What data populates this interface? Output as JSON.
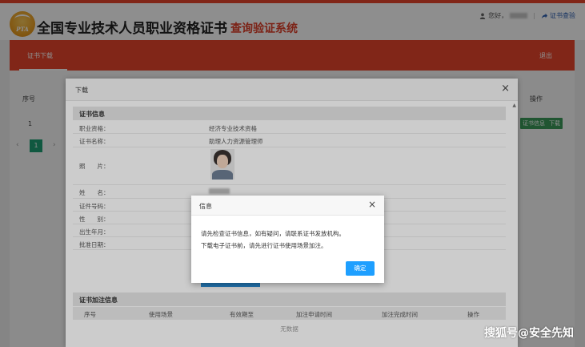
{
  "header": {
    "logo_text": "PTA",
    "title_main": "全国专业技术人员职业资格证书",
    "title_sub": "查询验证系统",
    "greeting": "您好，",
    "verify_link": "证书查验"
  },
  "nav": {
    "tab": "证书下载",
    "logout": "退出"
  },
  "background_table": {
    "col_index": "序号",
    "col_ops": "操作",
    "row_index": "1",
    "btn_info": "证书信息",
    "btn_download": "下载",
    "pager_prev": "‹",
    "pager_current": "1",
    "pager_next": "›"
  },
  "download_dialog": {
    "title": "下载",
    "close": "×",
    "section_cert": "证书信息",
    "rows": [
      {
        "label": "职业资格：",
        "value": "经济专业技术资格"
      },
      {
        "label": "证书名称：",
        "value": "助理人力资源管理师"
      },
      {
        "label": "照　　片：",
        "value": ""
      },
      {
        "label": "姓　　名：",
        "value": ""
      },
      {
        "label": "证件号码：",
        "value": ""
      },
      {
        "label": "性　　别：",
        "value": ""
      },
      {
        "label": "出生年月：",
        "value": ""
      },
      {
        "label": "批准日期：",
        "value": ""
      }
    ],
    "section_annot": "证书加注信息",
    "table_headers": [
      "序号",
      "使用场景",
      "有效期至",
      "加注申请时间",
      "加注完成时间",
      "操作"
    ],
    "empty_text": "无数据"
  },
  "message_dialog": {
    "title": "信息",
    "close": "×",
    "line1": "请先检查证书信息，如有疑问，请联系证书发放机构。",
    "line2": "下载电子证书前，请先进行证书使用场景加注。",
    "ok": "确定"
  },
  "watermark": "搜狐号@安全先知",
  "colors": {
    "brand_red": "#e8452c",
    "ok_blue": "#1e9fff",
    "green": "#1e9e73"
  }
}
